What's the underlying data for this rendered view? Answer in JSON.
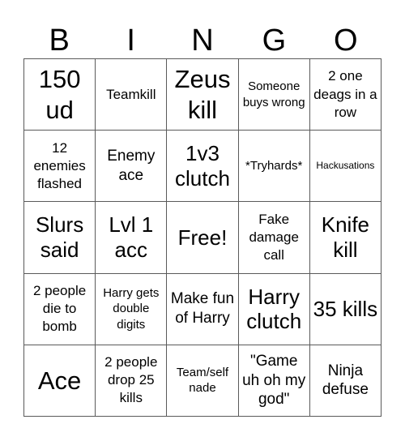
{
  "header": [
    "B",
    "I",
    "N",
    "G",
    "O"
  ],
  "rows": [
    [
      {
        "text": "150 ud",
        "size": "s-xl"
      },
      {
        "text": "Teamkill",
        "size": "s-s"
      },
      {
        "text": "Zeus kill",
        "size": "s-xl"
      },
      {
        "text": "Someone buys wrong",
        "size": "s-xs"
      },
      {
        "text": "2 one deags in a row",
        "size": "s-s"
      }
    ],
    [
      {
        "text": "12 enemies flashed",
        "size": "s-s"
      },
      {
        "text": "Enemy ace",
        "size": "s-m"
      },
      {
        "text": "1v3 clutch",
        "size": "s-l"
      },
      {
        "text": "*Tryhards*",
        "size": "s-xs"
      },
      {
        "text": "Hackusations",
        "size": "s-xxs"
      }
    ],
    [
      {
        "text": "Slurs said",
        "size": "s-l"
      },
      {
        "text": "Lvl 1 acc",
        "size": "s-l"
      },
      {
        "text": "Free!",
        "size": "s-l"
      },
      {
        "text": "Fake damage call",
        "size": "s-s"
      },
      {
        "text": "Knife kill",
        "size": "s-l"
      }
    ],
    [
      {
        "text": "2 people die to bomb",
        "size": "s-s"
      },
      {
        "text": "Harry gets double digits",
        "size": "s-xs"
      },
      {
        "text": "Make fun of Harry",
        "size": "s-m"
      },
      {
        "text": "Harry clutch",
        "size": "s-l"
      },
      {
        "text": "35 kills",
        "size": "s-l"
      }
    ],
    [
      {
        "text": "Ace",
        "size": "s-xl"
      },
      {
        "text": "2 people drop 25 kills",
        "size": "s-s"
      },
      {
        "text": "Team/self nade",
        "size": "s-xs"
      },
      {
        "text": "\"Game uh oh my god\"",
        "size": "s-m"
      },
      {
        "text": "Ninja defuse",
        "size": "s-m"
      }
    ]
  ]
}
